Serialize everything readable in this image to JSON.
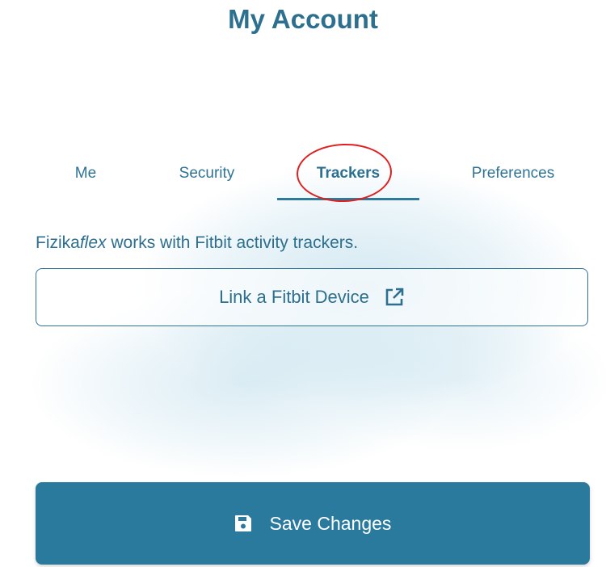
{
  "header": {
    "title": "My Account"
  },
  "tabs": [
    {
      "label": "Me",
      "active": false
    },
    {
      "label": "Security",
      "active": false
    },
    {
      "label": "Trackers",
      "active": true
    },
    {
      "label": "Preferences",
      "active": false
    }
  ],
  "trackers": {
    "brand_prefix": "Fizika",
    "brand_suffix": "flex",
    "description_rest": " works with Fitbit activity trackers.",
    "link_button_label": "Link a Fitbit Device",
    "link_button_icon": "external-link-icon"
  },
  "footer": {
    "save_label": "Save Changes",
    "save_icon": "floppy-disk-icon"
  },
  "colors": {
    "primary": "#2a7a9d",
    "text": "#2c6f8e",
    "annotation": "#e02020"
  }
}
